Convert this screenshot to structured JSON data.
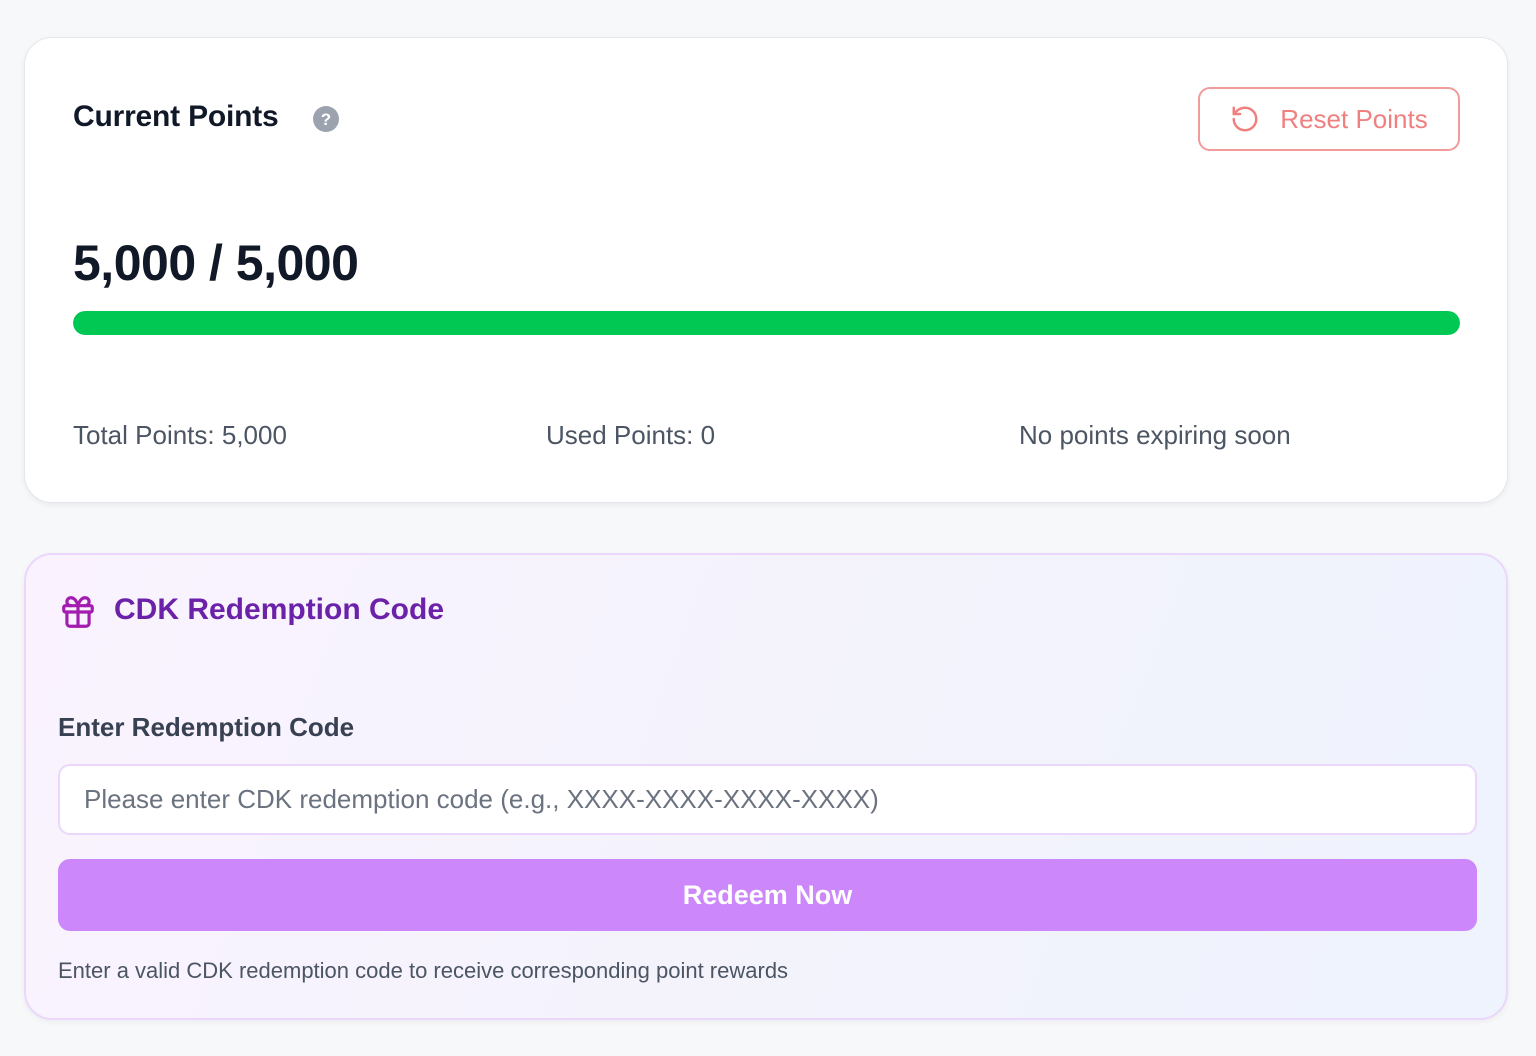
{
  "points_card": {
    "title": "Current Points",
    "help_icon": "question-circle-icon",
    "help_glyph": "?",
    "reset_button": {
      "label": "Reset Points",
      "icon": "rotate-ccw-icon",
      "color": "#f08080"
    },
    "current_points": "5,000 / 5,000",
    "progress": {
      "fraction": 1.0,
      "color": "#00c853"
    },
    "stats": {
      "total": "Total Points: 5,000",
      "used": "Used Points: 0",
      "expiring": "No points expiring soon"
    }
  },
  "cdk_card": {
    "icon": "gift-icon",
    "title": "CDK Redemption Code",
    "title_color": "#6b21a8",
    "input_label": "Enter Redemption Code",
    "input_value": "",
    "input_placeholder": "Please enter CDK redemption code (e.g., XXXX-XXXX-XXXX-XXXX)",
    "redeem_button": {
      "label": "Redeem Now",
      "color": "#cc88fb"
    },
    "helper_text": "Enter a valid CDK redemption code to receive corresponding point rewards"
  }
}
